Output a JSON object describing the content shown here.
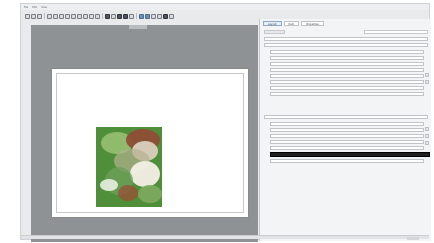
{
  "menubar": {
    "items": [
      "File",
      "Edit",
      "View"
    ]
  },
  "panel": {
    "tabs": [
      "Layout",
      "Item",
      "Properties"
    ]
  }
}
